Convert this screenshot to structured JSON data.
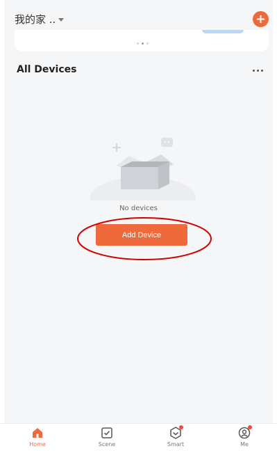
{
  "header": {
    "home_name": "我的家 ..",
    "add_icon": "plus-icon"
  },
  "section": {
    "title": "All Devices",
    "more_icon": "more-dots-icon"
  },
  "empty_state": {
    "message": "No devices",
    "button_label": "Add Device"
  },
  "tabs": [
    {
      "label": "Home",
      "icon": "home-icon",
      "active": true
    },
    {
      "label": "Scene",
      "icon": "scene-icon",
      "active": false
    },
    {
      "label": "Smart",
      "icon": "smart-icon",
      "active": false,
      "badge": true
    },
    {
      "label": "Me",
      "icon": "profile-icon",
      "active": false,
      "badge": true
    }
  ],
  "colors": {
    "accent": "#ee6a3d",
    "badge": "#ee4b3d",
    "background": "#f5f6f8",
    "annotation": "#d40000"
  }
}
